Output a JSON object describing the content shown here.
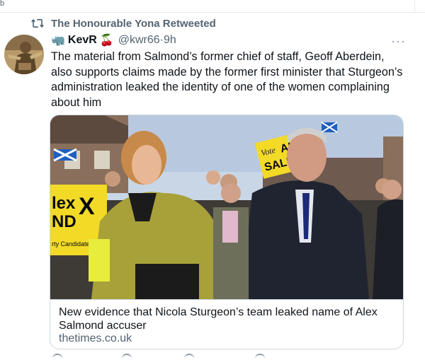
{
  "top_glyph": "b",
  "retweet": {
    "label": "The Honourable Yona Retweeted",
    "icon": "retweet-icon",
    "color": "#536471"
  },
  "tweet": {
    "avatar_icon": "avatar-photo",
    "emoji_before_name": "🦏",
    "author_name": "KevR",
    "emoji_after_name": "🍒",
    "handle": "@kwr66",
    "separator": "·",
    "time": "9h",
    "more_icon": "more-icon",
    "more_label": "···",
    "text": "The material from Salmond’s former chief of staff, Geoff Aberdein, also supports claims made by the former first minister that Sturgeon’s administration leaked the identity of one of the women complaining about him"
  },
  "card": {
    "image_icon": "news-photo",
    "image_sign_left": "lex\nND",
    "image_sign_candidate": "rty Candidate",
    "image_sign_right": "ALEX SALMO",
    "image_sign_vote": "Vote",
    "title": "New evidence that Nicola Sturgeon’s team leaked name of Alex Salmond accuser",
    "domain": "thetimes.co.uk"
  },
  "colors": {
    "text": "#0f1419",
    "secondary": "#536471",
    "border": "#cfd9de"
  }
}
